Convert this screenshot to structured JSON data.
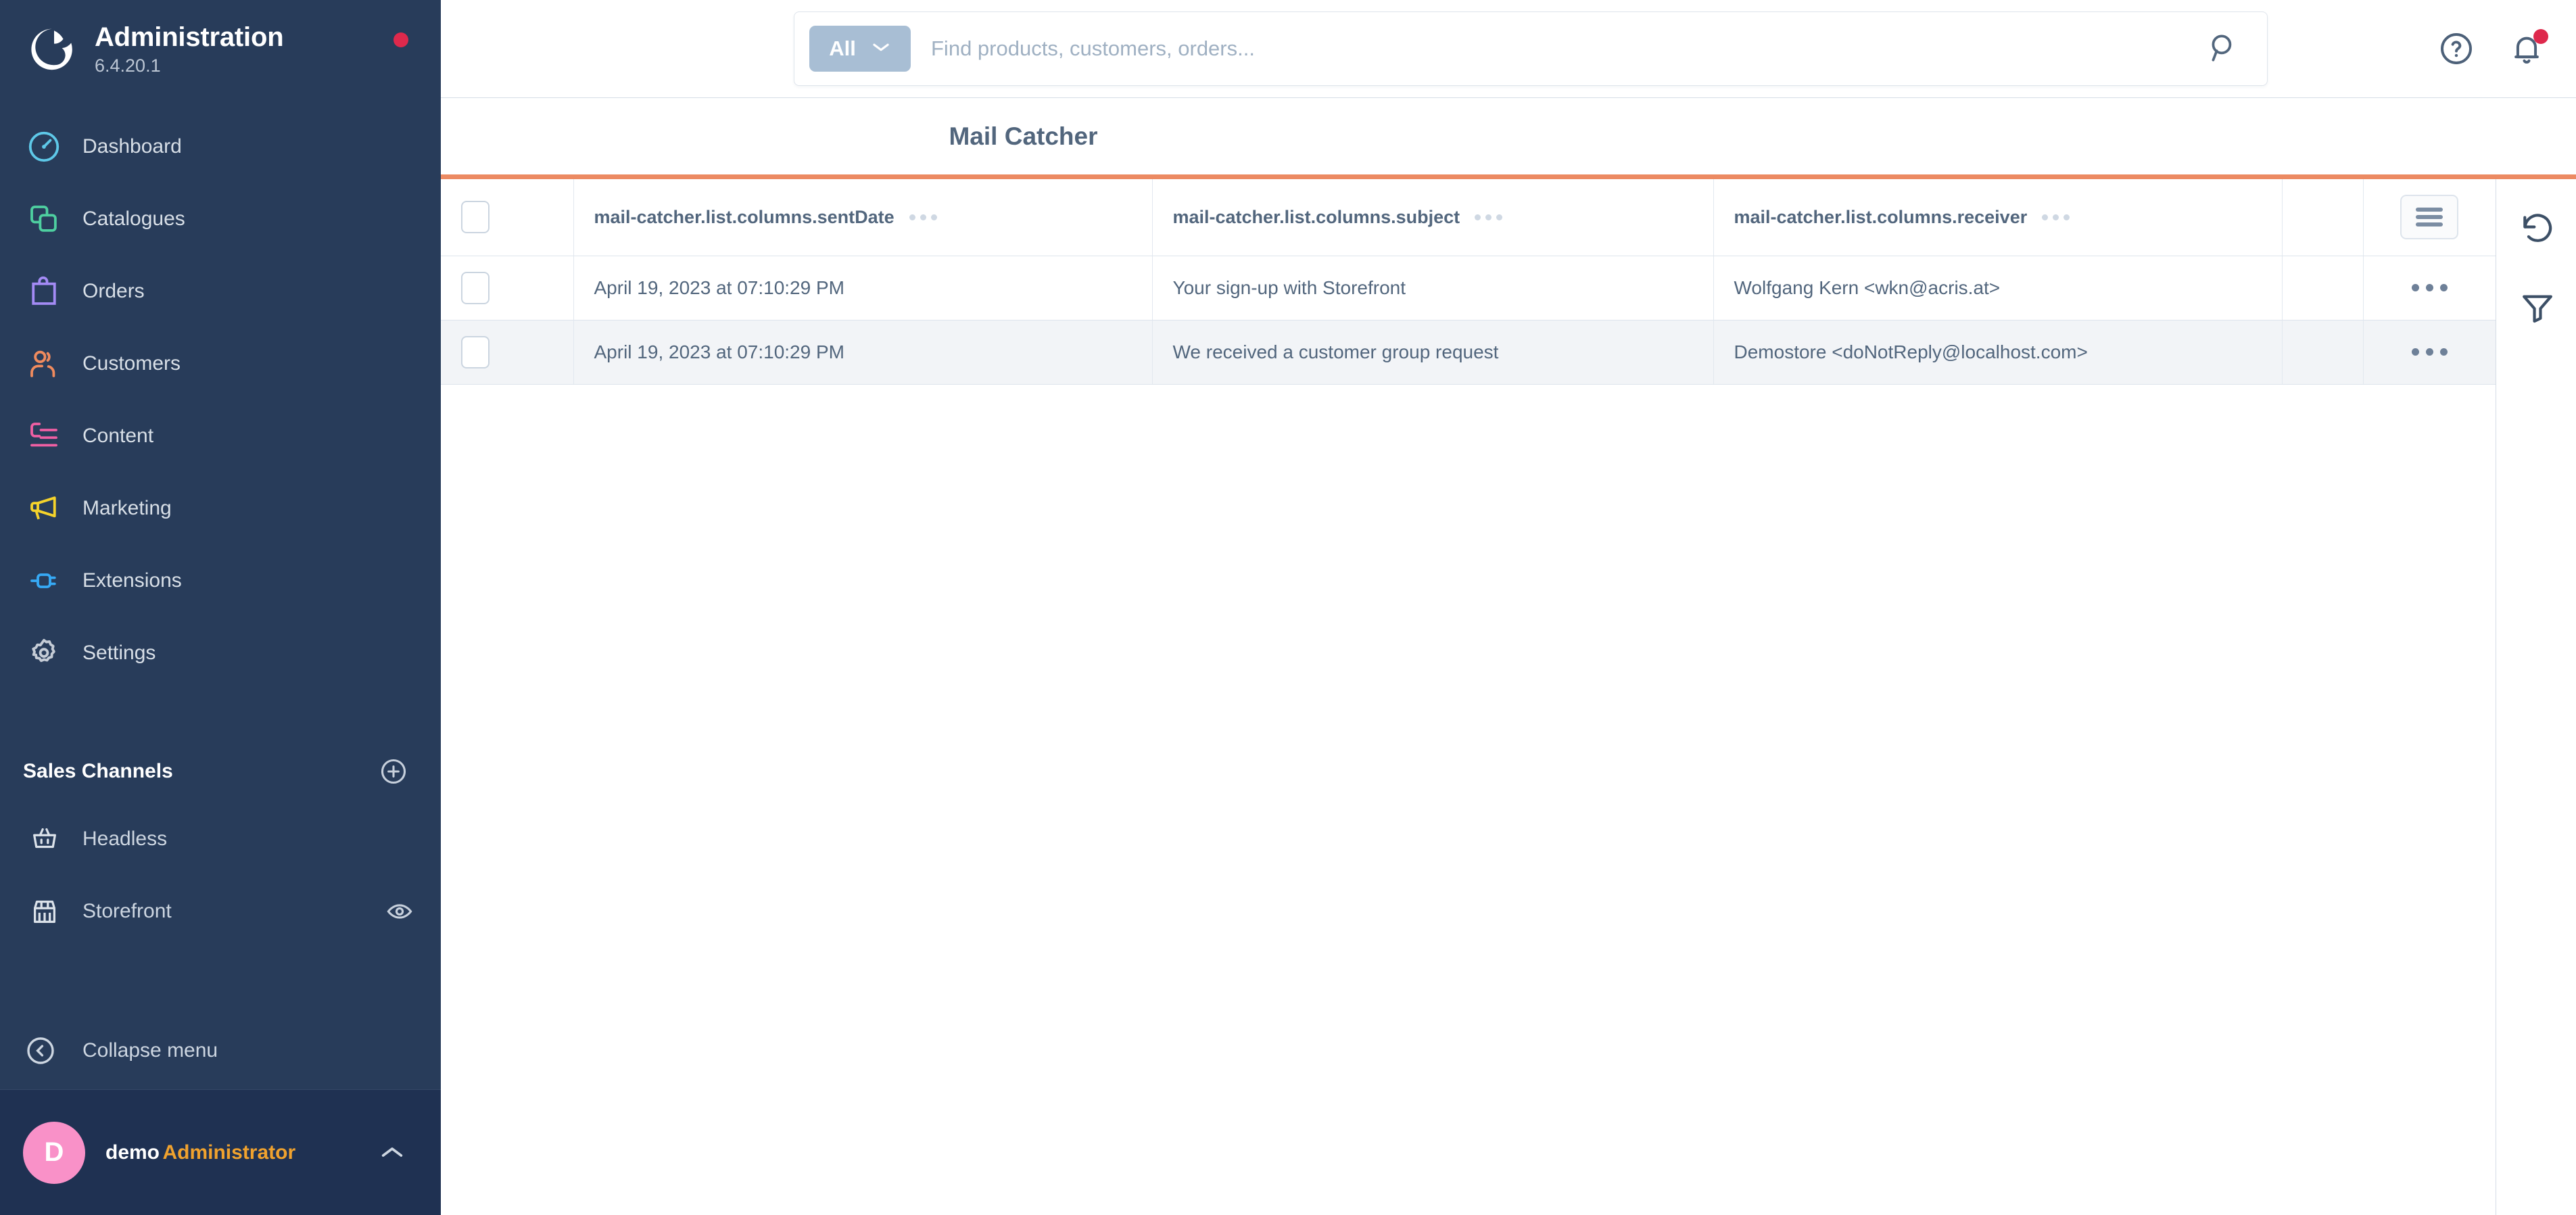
{
  "sidebar": {
    "brand": {
      "title": "Administration",
      "version": "6.4.20.1",
      "logo_icon": "shopware-logo-icon",
      "status_dot_color": "#de294c"
    },
    "items": [
      {
        "label": "Dashboard",
        "icon": "dashboard-speedometer-icon",
        "color": "#5ec8e8"
      },
      {
        "label": "Catalogues",
        "icon": "catalogues-layers-icon",
        "color": "#4ecfa0"
      },
      {
        "label": "Orders",
        "icon": "orders-bag-icon",
        "color": "#a48bf5"
      },
      {
        "label": "Customers",
        "icon": "customers-people-icon",
        "color": "#f08b5e"
      },
      {
        "label": "Content",
        "icon": "content-layout-icon",
        "color": "#ef5fa3"
      },
      {
        "label": "Marketing",
        "icon": "marketing-megaphone-icon",
        "color": "#f5d32b"
      },
      {
        "label": "Extensions",
        "icon": "extensions-plug-icon",
        "color": "#36a9f5"
      },
      {
        "label": "Settings",
        "icon": "settings-gear-icon",
        "color": "#c5ccd6"
      }
    ],
    "sales_channels": {
      "title": "Sales Channels",
      "add_icon": "plus-circle-icon",
      "channels": [
        {
          "label": "Headless",
          "icon": "basket-icon",
          "trailing_icon": null
        },
        {
          "label": "Storefront",
          "icon": "storefront-icon",
          "trailing_icon": "eye-icon"
        }
      ]
    },
    "collapse": {
      "label": "Collapse menu",
      "icon": "chevron-left-circle-icon"
    },
    "user": {
      "avatar_initial": "D",
      "avatar_color": "#f991c8",
      "name": "demo",
      "role": "Administrator",
      "role_color": "#f0a22e",
      "chevron_icon": "chevron-up-icon"
    }
  },
  "topbar": {
    "search": {
      "scope_label": "All",
      "scope_chevron_icon": "chevron-down-icon",
      "placeholder": "Find products, customers, orders...",
      "value": "",
      "submit_icon": "search-icon"
    },
    "actions": [
      {
        "name": "help-icon",
        "badge": false
      },
      {
        "name": "notification-bell-icon",
        "badge": true
      }
    ]
  },
  "page": {
    "title": "Mail Catcher",
    "accent_color": "#ec8a62"
  },
  "table": {
    "select_all_checked": false,
    "columns": [
      {
        "label": "mail-catcher.list.columns.sentDate",
        "menu_icon": "column-menu-icon"
      },
      {
        "label": "mail-catcher.list.columns.subject",
        "menu_icon": "column-menu-icon"
      },
      {
        "label": "mail-catcher.list.columns.receiver",
        "menu_icon": "column-menu-icon"
      }
    ],
    "columns_settings_icon": "list-settings-icon",
    "rows": [
      {
        "checked": false,
        "sentDate": "April 19, 2023 at 07:10:29 PM",
        "subject": "Your sign-up with Storefront",
        "receiver": "Wolfgang Kern <wkn@acris.at>",
        "actions_icon": "row-context-menu-icon"
      },
      {
        "checked": false,
        "sentDate": "April 19, 2023 at 07:10:29 PM",
        "subject": "We received a customer group request",
        "receiver": "Demostore <doNotReply@localhost.com>",
        "actions_icon": "row-context-menu-icon"
      }
    ]
  },
  "right_rail": {
    "items": [
      {
        "name": "refresh-icon"
      },
      {
        "name": "filter-funnel-icon"
      }
    ]
  }
}
